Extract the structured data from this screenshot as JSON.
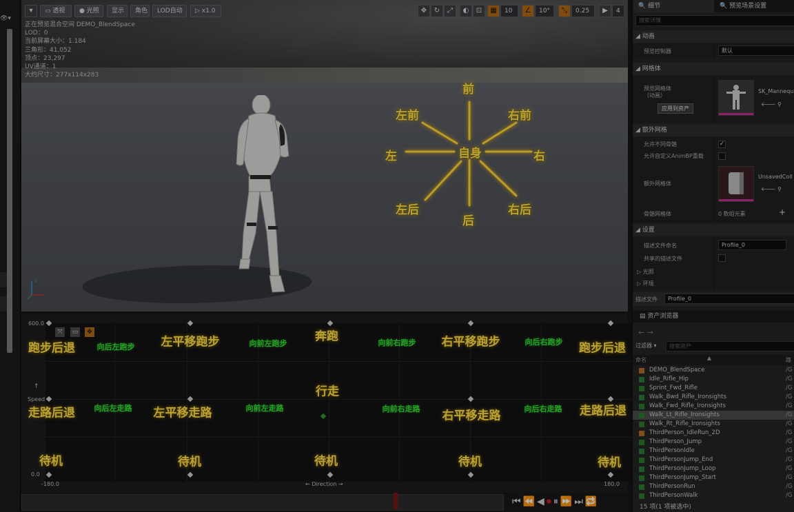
{
  "viewport": {
    "toolbar": {
      "perspective": "透视",
      "lit": "光照",
      "show": "显示",
      "character": "角色",
      "lod": "LOD自动",
      "speed": "x1.0",
      "grid_snap": "10",
      "rot_snap": "10°",
      "scale_snap": "0.25",
      "cam_speed": "4"
    },
    "info_lines": [
      "正在预览混合空间 DEMO_BlendSpace",
      "LOD：0",
      "当前屏幕大小：1.184",
      "三角形：41,052",
      "顶点：23,297",
      "UV通道：1",
      "大约尺寸：277x114x283"
    ],
    "directions": {
      "front": "前",
      "front_left": "左前",
      "front_right": "右前",
      "left": "左",
      "self": "自身",
      "right": "右",
      "back_left": "左后",
      "back": "后",
      "back_right": "右后"
    }
  },
  "blendspace": {
    "y_max": "600.0",
    "y_min": "0.0",
    "x_min": "-180.0",
    "x_max": "180.0",
    "y_axis": "Speed",
    "x_axis": "Direction",
    "labels": {
      "run_back_left": "跑步后退",
      "fwd_left_run_back": "向后左跑步",
      "left_strafe_run": "左平移跑步",
      "fwd_left_run": "向前左跑步",
      "sprint": "奔跑",
      "fwd_right_run": "向前右跑步",
      "right_strafe_run": "右平移跑步",
      "back_right_run": "向后右跑步",
      "run_back_right": "跑步后退",
      "walk_back_left": "走路后退",
      "back_left_walk": "向后左走路",
      "left_strafe_walk": "左平移走路",
      "fwd_left_walk": "向前左走路",
      "walk": "行走",
      "fwd_right_walk": "向前右走路",
      "right_strafe_walk": "右平移走路",
      "back_right_walk": "向后右走路",
      "walk_back_right": "走路后退",
      "idle_1": "待机",
      "idle_2": "待机",
      "idle_3": "待机",
      "idle_4": "待机",
      "idle_5": "待机"
    }
  },
  "details": {
    "tabs": [
      "细节",
      "预览场景设置"
    ],
    "search_placeholder": "搜索详情",
    "sections": {
      "animation": "动画",
      "mesh": "网格体",
      "extra_mesh": "额外网格",
      "settings": "设置"
    },
    "rows": {
      "preview_controller": "预览控制器",
      "preview_controller_value": "默认",
      "preview_mesh": "预览网格体\n（动画）",
      "mesh_asset": "SK_Mannequ",
      "apply_to_asset": "应用到资产",
      "allow_diff_skeleton": "允许不同骨骼",
      "allow_custom_animbp": "允许自定义AnimBP重载",
      "extra_mesh": "额外网格体",
      "extra_mesh_asset": "UnsavedColl",
      "skeletal_mesh": "骨骼网格体",
      "skeletal_mesh_value": "0 数组元素",
      "profile_name": "描述文件命名",
      "profile_value": "Profile_0",
      "shared_profile": "共享的描述文件",
      "lighting": "光照",
      "environment": "环境",
      "profile_label": "描述文件",
      "profile_select": "Profile_0"
    }
  },
  "asset_browser": {
    "title": "资产浏览器",
    "filter": "过滤器",
    "search_placeholder": "搜索资产",
    "col_name": "命名",
    "col_path": "路",
    "items": [
      {
        "name": "DEMO_BlendSpace",
        "path": "/G",
        "icon": "blendspace"
      },
      {
        "name": "Idle_Rifle_Hip",
        "path": "/G",
        "icon": "anim"
      },
      {
        "name": "Sprint_Fwd_Rifle",
        "path": "/G",
        "icon": "anim"
      },
      {
        "name": "Walk_Bwd_Rifle_Ironsights",
        "path": "/G",
        "icon": "anim"
      },
      {
        "name": "Walk_Fwd_Rifle_Ironsights",
        "path": "/G",
        "icon": "anim"
      },
      {
        "name": "Walk_Lt_Rifle_Ironsights",
        "path": "/G",
        "icon": "anim"
      },
      {
        "name": "Walk_Rt_Rifle_Ironsights",
        "path": "/G",
        "icon": "anim"
      },
      {
        "name": "ThirdPerson_IdleRun_2D",
        "path": "/G",
        "icon": "blendspace"
      },
      {
        "name": "ThirdPerson_Jump",
        "path": "/G",
        "icon": "anim"
      },
      {
        "name": "ThirdPersonIdle",
        "path": "/G",
        "icon": "anim"
      },
      {
        "name": "ThirdPersonJump_End",
        "path": "/G",
        "icon": "anim"
      },
      {
        "name": "ThirdPersonJump_Loop",
        "path": "/G",
        "icon": "anim"
      },
      {
        "name": "ThirdPersonJump_Start",
        "path": "/G",
        "icon": "anim"
      },
      {
        "name": "ThirdPersonRun",
        "path": "/G",
        "icon": "anim"
      },
      {
        "name": "ThirdPersonWalk",
        "path": "/G",
        "icon": "anim"
      }
    ],
    "footer": "15 项(1 项被选中)",
    "selected_index": 5
  }
}
